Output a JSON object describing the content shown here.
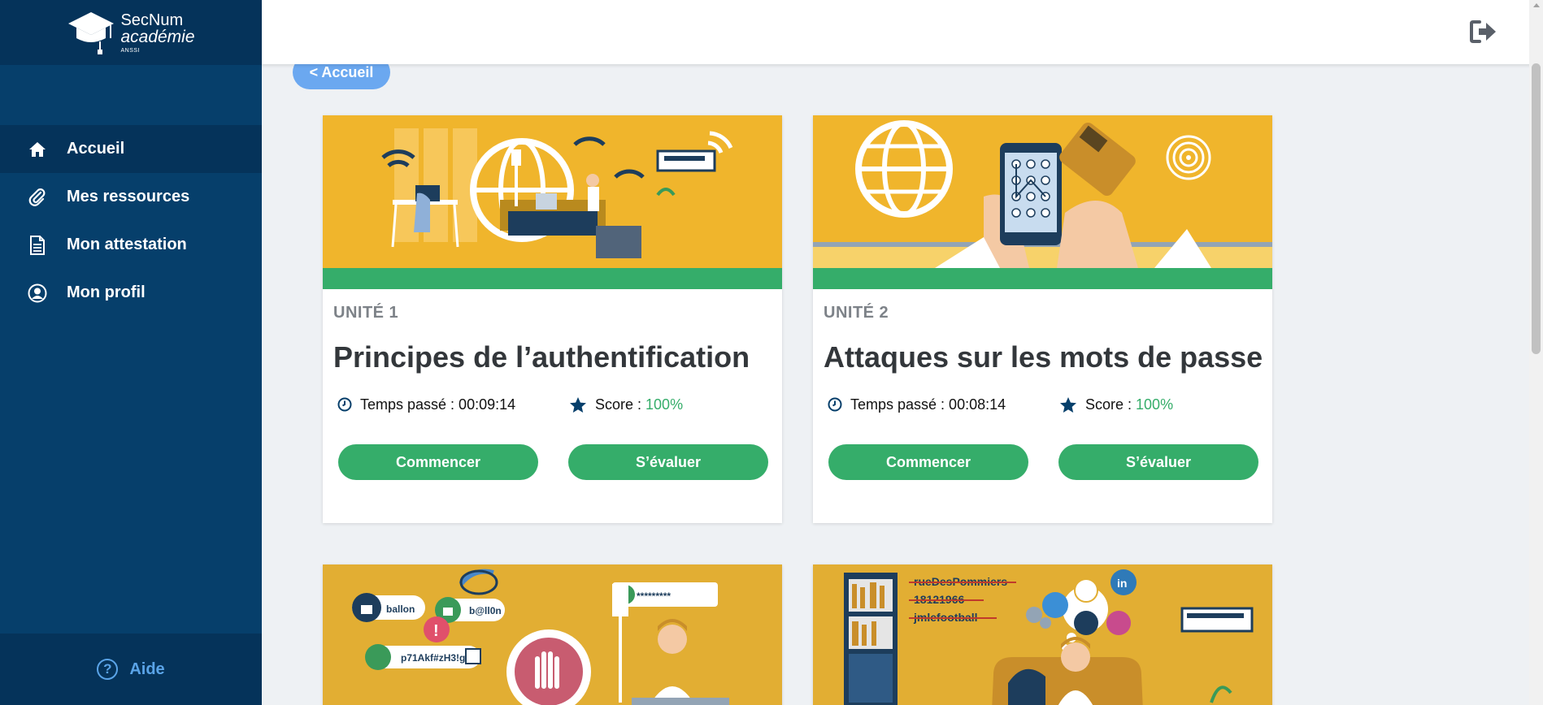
{
  "logo": {
    "title": "SecNum",
    "subtitle": "académie",
    "org": "ANSSI"
  },
  "sidebar": {
    "items": [
      {
        "label": "Accueil",
        "icon": "home-icon",
        "active": true
      },
      {
        "label": "Mes ressources",
        "icon": "paperclip-icon"
      },
      {
        "label": "Mon attestation",
        "icon": "document-icon"
      },
      {
        "label": "Mon profil",
        "icon": "user-circle-icon"
      }
    ],
    "help_label": "Aide"
  },
  "topbar": {
    "logout_icon": "logout-icon"
  },
  "back_button": {
    "label": "< Accueil"
  },
  "units": [
    {
      "unit_label": "UNITÉ 1",
      "title": "Principes de l’authentification",
      "time_label": "Temps passé : 00:09:14",
      "score_label": "Score :",
      "score_value": "100%",
      "progress": 1.0,
      "start_label": "Commencer",
      "evaluate_label": "S’évaluer"
    },
    {
      "unit_label": "UNITÉ 2",
      "title": "Attaques sur les mots de passe",
      "time_label": "Temps passé : 00:08:14",
      "score_label": "Score :",
      "score_value": "100%",
      "progress": 1.0,
      "start_label": "Commencer",
      "evaluate_label": "S’évaluer"
    }
  ],
  "illustrations": {
    "card3": {
      "words": [
        "ballon",
        "b@ll0n",
        "p71Akf#zH3!gZ",
        "*********"
      ]
    },
    "card4": {
      "words": [
        "rueDesPommiers",
        "18121966",
        "jmlefootball"
      ]
    }
  },
  "colors": {
    "sidebar": "#063f6b",
    "sidebar_dark": "#05335a",
    "accent_green": "#35ad6a",
    "illustration_yellow": "#f0b52c",
    "back_button": "#6ba8f0"
  }
}
